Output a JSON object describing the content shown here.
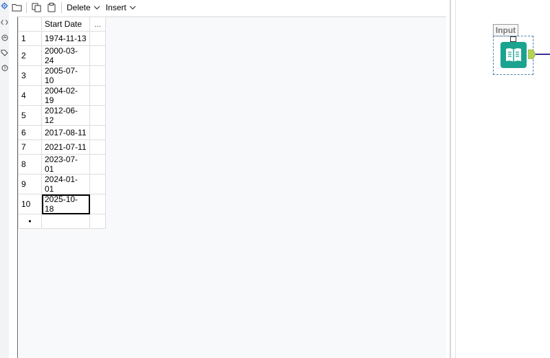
{
  "toolbar": {
    "open_icon": "folder-icon",
    "copy_icon": "copy-icon",
    "paste_icon": "paste-icon",
    "delete_label": "Delete",
    "insert_label": "Insert"
  },
  "rail": {
    "icons": [
      "gear-icon",
      "code-icon",
      "annotation-icon",
      "tag-icon",
      "help-icon"
    ]
  },
  "grid": {
    "headers": [
      "Start Date",
      "..."
    ],
    "rows": [
      {
        "num": "1",
        "value": "1974-11-13"
      },
      {
        "num": "2",
        "value": "2000-03-24"
      },
      {
        "num": "3",
        "value": "2005-07-10"
      },
      {
        "num": "4",
        "value": "2004-02-19"
      },
      {
        "num": "5",
        "value": "2012-06-12"
      },
      {
        "num": "6",
        "value": "2017-08-11"
      },
      {
        "num": "7",
        "value": "2021-07-11"
      },
      {
        "num": "8",
        "value": "2023-07-01"
      },
      {
        "num": "9",
        "value": "2024-01-01"
      },
      {
        "num": "10",
        "value": "2025-10-18"
      }
    ],
    "selected_row": "10",
    "new_row_marker": "•"
  },
  "canvas": {
    "tool_label": "Input",
    "tool_icon": "text-input-book-icon",
    "tool_color": "#1aa38f",
    "anchor_color": "#b5d35a",
    "connection_color": "#3b2f8f"
  }
}
